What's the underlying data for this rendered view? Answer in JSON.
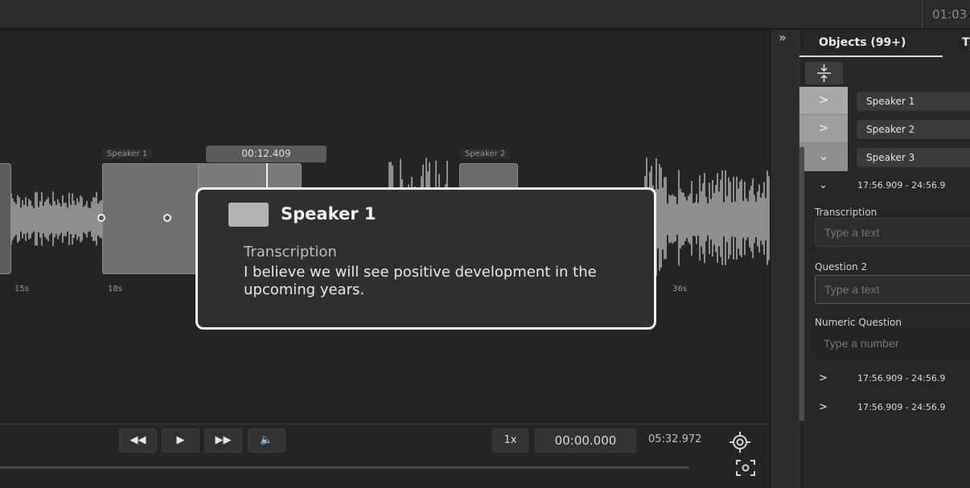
{
  "topbar": {
    "time": "01:03"
  },
  "waveform": {
    "regions": [
      {
        "label": "Speaker 1"
      },
      {
        "label": "Speaker 2"
      }
    ],
    "playhead_time": "00:12.409",
    "ticks": [
      "15s",
      "18s",
      "36s"
    ]
  },
  "tooltip": {
    "speaker": "Speaker 1",
    "label": "Transcription",
    "text": "I believe we will see positive development in the upcoming years."
  },
  "player": {
    "buttons": {
      "rewind": "◀◀",
      "play": "▶",
      "forward": "▶▶",
      "volume": "🔈"
    },
    "speed": "1x",
    "current_time": "00:00.000",
    "duration": "05:32.972",
    "icons": {
      "target": "target-icon",
      "fit": "fit-screen-icon"
    }
  },
  "collapse": {
    "icon": "»"
  },
  "panel": {
    "tabs": [
      "Objects (99+)",
      "T"
    ],
    "objects": [
      {
        "toggle": ">",
        "name": "Speaker 1"
      },
      {
        "toggle": ">",
        "name": "Speaker 2"
      },
      {
        "toggle": "⌄",
        "name": "Speaker 3"
      }
    ],
    "segments": [
      {
        "chev": "⌄",
        "range": "17:56.909 - 24:56.9"
      },
      {
        "chev": ">",
        "range": "17:56.909 - 24:56.9"
      },
      {
        "chev": ">",
        "range": "17:56.909 - 24:56.9"
      }
    ],
    "fields": {
      "transcription_label": "Transcription",
      "transcription_placeholder": "Type a text",
      "question2_label": "Question 2",
      "question2_placeholder": "Type a text",
      "numeric_label": "Numeric Question",
      "numeric_placeholder": "Type a number"
    }
  }
}
